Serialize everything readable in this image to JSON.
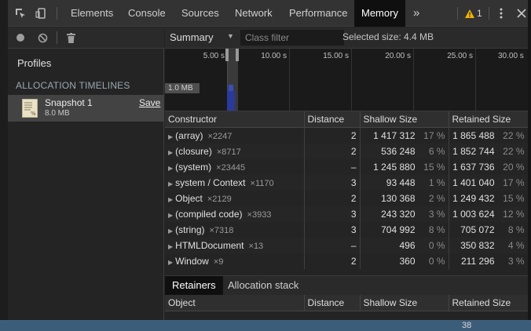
{
  "toolbar": {
    "tabs": [
      {
        "label": "Elements"
      },
      {
        "label": "Console"
      },
      {
        "label": "Sources"
      },
      {
        "label": "Network"
      },
      {
        "label": "Performance"
      },
      {
        "label": "Memory"
      }
    ],
    "more_icon": "»",
    "warning_count": "1",
    "active_tab": "Memory"
  },
  "sidebar": {
    "profiles_header": "Profiles",
    "section_header": "ALLOCATION TIMELINES",
    "snapshot": {
      "name": "Snapshot 1",
      "size": "8.0 MB",
      "save_label": "Save"
    }
  },
  "view_toolbar": {
    "view_select": "Summary",
    "class_filter_placeholder": "Class filter",
    "selected_size": "Selected size: 4.4 MB"
  },
  "timeline": {
    "tick_labels": [
      "5.00 s",
      "10.00 s",
      "15.00 s",
      "20.00 s",
      "25.00 s",
      "30.00 s"
    ],
    "memory_label": "1.0 MB"
  },
  "table": {
    "headers": [
      "Constructor",
      "Distance",
      "Shallow Size",
      "Retained Size"
    ],
    "rows": [
      {
        "name": "(array)",
        "count": "×2247",
        "distance": "2",
        "shallow": "1 417 312",
        "shallow_pct": "17 %",
        "retained": "1 865 488",
        "retained_pct": "22 %"
      },
      {
        "name": "(closure)",
        "count": "×8717",
        "distance": "2",
        "shallow": "536 248",
        "shallow_pct": "6 %",
        "retained": "1 852 744",
        "retained_pct": "22 %"
      },
      {
        "name": "(system)",
        "count": "×23445",
        "distance": "–",
        "shallow": "1 245 880",
        "shallow_pct": "15 %",
        "retained": "1 637 736",
        "retained_pct": "20 %"
      },
      {
        "name": "system / Context",
        "count": "×1170",
        "distance": "3",
        "shallow": "93 448",
        "shallow_pct": "1 %",
        "retained": "1 401 040",
        "retained_pct": "17 %"
      },
      {
        "name": "Object",
        "count": "×2129",
        "distance": "2",
        "shallow": "130 368",
        "shallow_pct": "2 %",
        "retained": "1 249 432",
        "retained_pct": "15 %"
      },
      {
        "name": "(compiled code)",
        "count": "×3933",
        "distance": "3",
        "shallow": "243 320",
        "shallow_pct": "3 %",
        "retained": "1 003 624",
        "retained_pct": "12 %"
      },
      {
        "name": "(string)",
        "count": "×7318",
        "distance": "3",
        "shallow": "704 992",
        "shallow_pct": "8 %",
        "retained": "705 072",
        "retained_pct": "8 %"
      },
      {
        "name": "HTMLDocument",
        "count": "×13",
        "distance": "–",
        "shallow": "496",
        "shallow_pct": "0 %",
        "retained": "350 832",
        "retained_pct": "4 %"
      },
      {
        "name": "Window",
        "count": "×9",
        "distance": "2",
        "shallow": "360",
        "shallow_pct": "0 %",
        "retained": "211 296",
        "retained_pct": "3 %"
      }
    ]
  },
  "bottom": {
    "tabs": [
      {
        "label": "Retainers"
      },
      {
        "label": "Allocation stack"
      }
    ],
    "headers": [
      "Object",
      "Distance",
      "Shallow Size",
      "Retained Size"
    ]
  },
  "strip": {
    "page_number": "38"
  },
  "colors": {
    "panel_bg": "#242424",
    "toolbar_bg": "#333333",
    "active_tab_bg": "#0f0f0f",
    "selected_row_bg": "#434343",
    "timeline_bar": "#2a3a9a",
    "warning": "#f0b400"
  }
}
